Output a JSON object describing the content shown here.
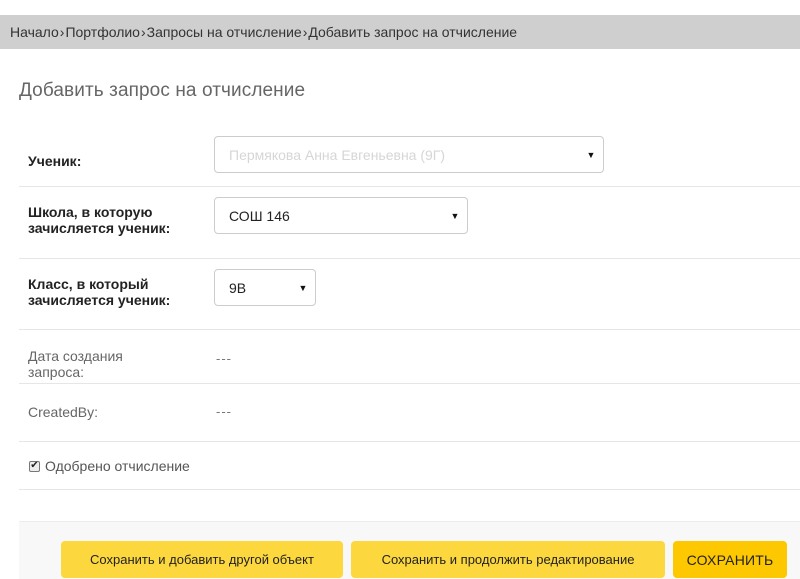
{
  "breadcrumbs": [
    {
      "label": "Начало"
    },
    {
      "label": "Портфолио"
    },
    {
      "label": "Запросы на отчисление"
    },
    {
      "label": "Добавить запрос на отчисление"
    }
  ],
  "breadcrumb_separator": "›",
  "page_title": "Добавить запрос на отчисление",
  "form": {
    "student": {
      "label": "Ученик:",
      "value": "Пермякова Анна Евгеньевна (9Г)"
    },
    "school": {
      "label": "Школа, в которую зачисляется ученик:",
      "value": "СОШ 146"
    },
    "class": {
      "label": "Класс, в который зачисляется ученик:",
      "value": "9В"
    },
    "created_date": {
      "label": "Дата создания запроса:",
      "value": "---"
    },
    "created_by": {
      "label": "CreatedBy:",
      "value": "---"
    },
    "approved": {
      "label": "Одобрено отчисление",
      "checked": true
    }
  },
  "select_arrow": "▼",
  "checkbox_mark": "✔",
  "buttons": {
    "save_add_another": "Сохранить и добавить другой объект",
    "save_continue": "Сохранить и продолжить редактирование",
    "save": "СОХРАНИТЬ"
  },
  "colors": {
    "header_bg": "#cfcfcf",
    "button_bg": "#fcd83e",
    "primary_button_bg": "#fdc800"
  }
}
